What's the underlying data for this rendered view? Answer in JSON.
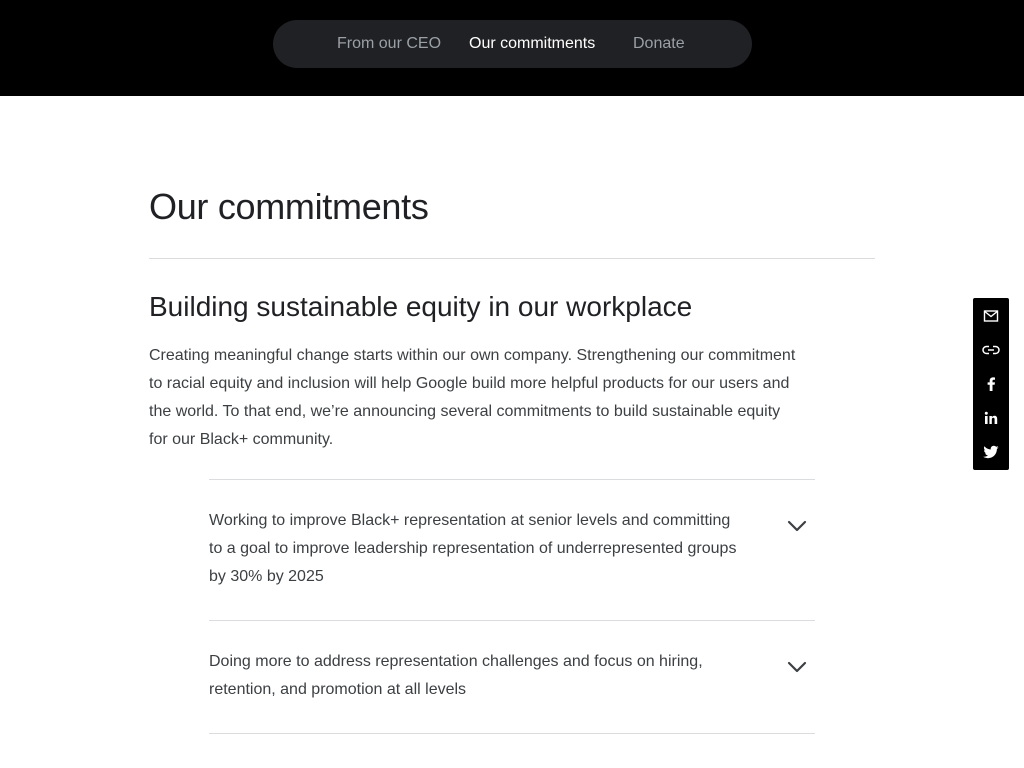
{
  "nav": {
    "items": [
      {
        "label": "From our CEO",
        "active": false
      },
      {
        "label": "Our commitments",
        "active": true
      },
      {
        "label": "Donate",
        "active": false
      }
    ]
  },
  "page": {
    "title": "Our commitments"
  },
  "section": {
    "heading": "Building sustainable equity in our workplace",
    "body": "Creating meaningful change starts within our own company. Strengthening our commitment to racial equity and inclusion will help Google build more helpful products for our users and the world. To that end, we’re announcing several commitments to build sustainable equity for our Black+ community."
  },
  "accordion": {
    "items": [
      {
        "text": "Working to improve Black+ representation at senior levels and committing to a goal to improve leadership representation of underrepresented groups by 30% by 2025",
        "expanded": false
      },
      {
        "text": "Doing more to address representation challenges and focus on hiring, retention, and promotion at all levels",
        "expanded": false
      }
    ]
  },
  "share": {
    "icons": [
      "email-icon",
      "link-icon",
      "facebook-icon",
      "linkedin-icon",
      "twitter-icon"
    ]
  },
  "colors": {
    "header_bg": "#000000",
    "nav_pill_bg": "#202124",
    "nav_active": "#ffffff",
    "nav_inactive": "#9aa0a6",
    "divider": "#dadce0",
    "body_text": "#3c4043"
  }
}
